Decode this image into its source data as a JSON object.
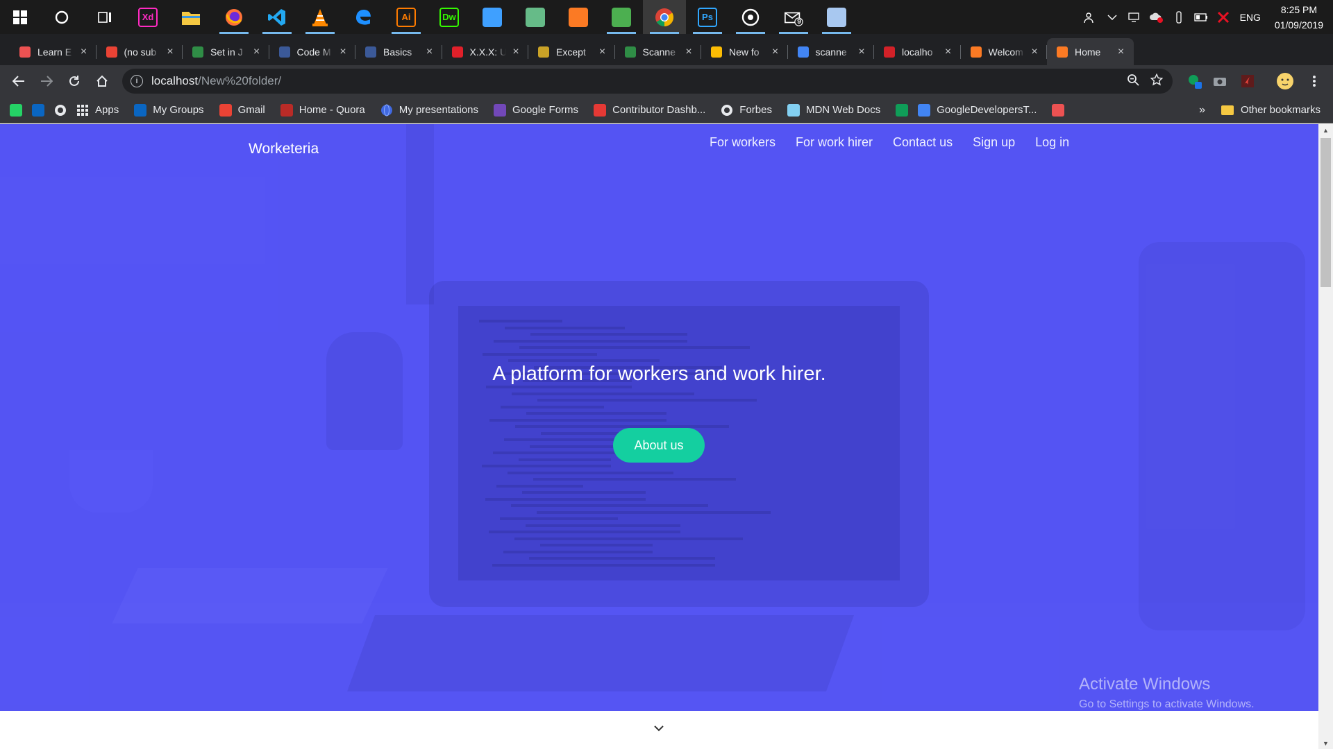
{
  "taskbar": {
    "apps": [
      {
        "name": "Cortana",
        "icon": "cortana-icon"
      },
      {
        "name": "Task View",
        "icon": "task-view-icon"
      },
      {
        "name": "Adobe XD",
        "icon": "xd-icon",
        "label": "Xd",
        "color": "#ff2bc2"
      },
      {
        "name": "File Explorer",
        "icon": "folder-icon",
        "color": "#f5c842"
      },
      {
        "name": "Firefox",
        "icon": "firefox-icon",
        "color": "#ff7139"
      },
      {
        "name": "VS Code",
        "icon": "vscode-icon",
        "color": "#23a9f2"
      },
      {
        "name": "VLC",
        "icon": "vlc-icon",
        "color": "#ff8800"
      },
      {
        "name": "Edge",
        "icon": "edge-icon",
        "color": "#1e90ff"
      },
      {
        "name": "Illustrator",
        "icon": "ai-icon",
        "label": "Ai",
        "color": "#ff7c00"
      },
      {
        "name": "Dreamweaver",
        "icon": "dw-icon",
        "label": "Dw",
        "color": "#35fa00"
      },
      {
        "name": "App",
        "icon": "cube-gradient-icon",
        "color": "#3fa0ff"
      },
      {
        "name": "Atom",
        "icon": "atom-icon",
        "color": "#66bb88"
      },
      {
        "name": "XAMPP",
        "icon": "xampp-icon",
        "color": "#fb7a24"
      },
      {
        "name": "App",
        "icon": "tool-icon",
        "color": "#4caf50"
      },
      {
        "name": "Chrome",
        "icon": "chrome-icon",
        "color": "#4285f4"
      },
      {
        "name": "Photoshop",
        "icon": "ps-icon",
        "label": "Ps",
        "color": "#31a8ff"
      },
      {
        "name": "App",
        "icon": "target-icon",
        "color": "#ffffff"
      },
      {
        "name": "Mail",
        "icon": "mail-icon",
        "color": "#ffffff",
        "badge": "9"
      },
      {
        "name": "App",
        "icon": "box-icon",
        "color": "#a8c8f0"
      }
    ],
    "tray": {
      "language": "ENG",
      "time": "8:25 PM",
      "date": "01/09/2019"
    }
  },
  "browser": {
    "tabs": [
      {
        "title": "Learn E",
        "favicon": "udemy-icon",
        "color": "#ec5252"
      },
      {
        "title": "(no sub",
        "favicon": "gmail-icon",
        "color": "#ea4335"
      },
      {
        "title": "Set in J",
        "favicon": "gfg-icon",
        "color": "#2f8d46"
      },
      {
        "title": "Code M",
        "favicon": "doc-icon",
        "color": "#3b5998"
      },
      {
        "title": "Basics",
        "favicon": "doc-icon",
        "color": "#3b5998"
      },
      {
        "title": "X.X.X: U",
        "favicon": "k-icon",
        "color": "#e0202a"
      },
      {
        "title": "Except",
        "favicon": "shield-icon",
        "color": "#c9a227"
      },
      {
        "title": "Scanne",
        "favicon": "gfg-icon",
        "color": "#2f8d46"
      },
      {
        "title": "New fo",
        "favicon": "drive-icon",
        "color": "#fbbc04"
      },
      {
        "title": "scanne",
        "favicon": "google-icon",
        "color": "#4285f4"
      },
      {
        "title": "localho",
        "favicon": "apache-icon",
        "color": "#d22128"
      },
      {
        "title": "Welcom",
        "favicon": "xampp-icon",
        "color": "#fb7a24"
      },
      {
        "title": "Home",
        "favicon": "xampp-icon",
        "color": "#fb7a24",
        "active": true
      }
    ],
    "url_host": "localhost",
    "url_path": "/New%20folder/",
    "bookmarks": [
      {
        "label": "",
        "icon": "whatsapp-icon",
        "color": "#25d366"
      },
      {
        "label": "",
        "icon": "linkedin-icon",
        "color": "#0a66c2"
      },
      {
        "label": "",
        "icon": "github-icon",
        "color": "#ffffff"
      },
      {
        "label": "Apps",
        "icon": "apps-grid-icon",
        "color": "#e8eaed"
      },
      {
        "label": "My Groups",
        "icon": "linkedin-icon",
        "color": "#0a66c2"
      },
      {
        "label": "Gmail",
        "icon": "gmail-icon",
        "color": "#ea4335"
      },
      {
        "label": "Home - Quora",
        "icon": "quora-icon",
        "color": "#b92b27"
      },
      {
        "label": "My presentations",
        "icon": "globe-icon",
        "color": "#4169e1"
      },
      {
        "label": "Google Forms",
        "icon": "forms-icon",
        "color": "#7248b9"
      },
      {
        "label": "Contributor Dashb...",
        "icon": "contributor-icon",
        "color": "#e53935"
      },
      {
        "label": "Forbes",
        "icon": "forbes-icon",
        "color": "#ffffff"
      },
      {
        "label": "MDN Web Docs",
        "icon": "mdn-icon",
        "color": "#83d0f2"
      },
      {
        "label": "",
        "icon": "hangouts-icon",
        "color": "#0f9d58"
      },
      {
        "label": "GoogleDevelopersT...",
        "icon": "google-dev-icon",
        "color": "#4285f4"
      },
      {
        "label": "",
        "icon": "udemy-icon",
        "color": "#ec5252"
      }
    ],
    "other_bookmarks": "Other bookmarks"
  },
  "page": {
    "brand": "Worketeria",
    "nav": [
      "For workers",
      "For work hirer",
      "Contact us",
      "Sign up",
      "Log in"
    ],
    "headline": "A platform for workers and work hirer.",
    "cta": "About us",
    "colors": {
      "hero": "#5454f3",
      "cta": "#14cfa0"
    }
  },
  "watermark": {
    "line1": "Activate Windows",
    "line2": "Go to Settings to activate Windows."
  }
}
